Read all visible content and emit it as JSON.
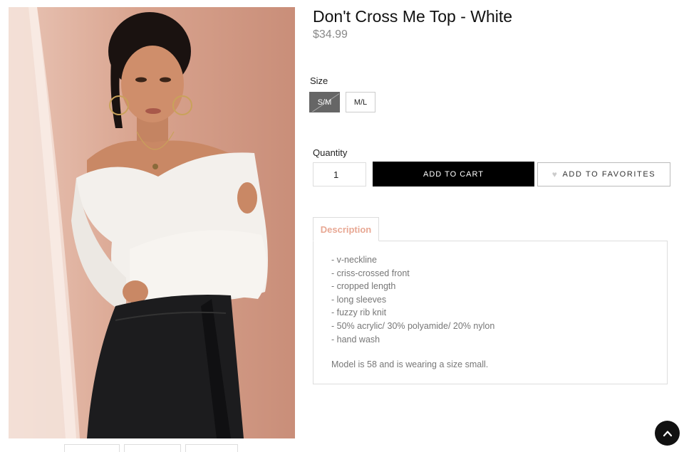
{
  "product": {
    "title": "Don't Cross Me Top - White",
    "price": "$34.99"
  },
  "size": {
    "label": "Size",
    "options": [
      "S/M",
      "M/L"
    ],
    "selected": "S/M"
  },
  "quantity": {
    "label": "Quantity",
    "value": "1"
  },
  "actions": {
    "add_to_cart": "ADD TO CART",
    "add_to_favorites": "ADD TO FAVORITES"
  },
  "description": {
    "tab_label": "Description",
    "bullets": [
      "- v-neckline",
      "- criss-crossed front",
      "- cropped length",
      "- long sleeves",
      "- fuzzy rib knit",
      "- 50% acrylic/ 30% polyamide/ 20% nylon",
      "- hand wash"
    ],
    "note": "Model is 58 and is wearing a size small."
  },
  "colors": {
    "accent": "#e8a894",
    "cart_button": "#000000",
    "selected_size": "#666666"
  },
  "icons": {
    "favorite": "heart-icon",
    "scroll_top": "chevron-up-icon"
  }
}
